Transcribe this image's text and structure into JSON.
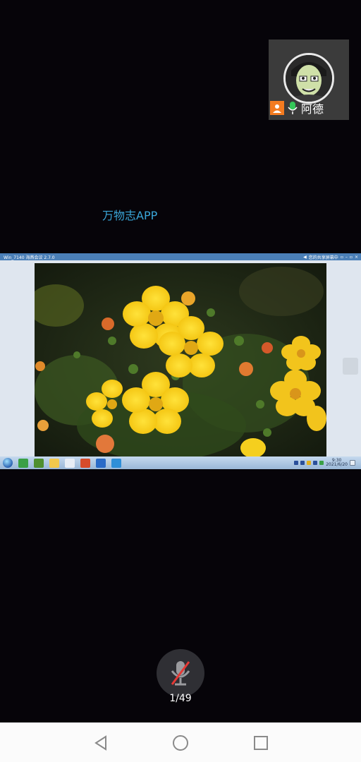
{
  "participant": {
    "name": "阿德",
    "role_icon": "person-icon",
    "mic_icon": "mic-on-icon",
    "accent_color": "#f47b20",
    "mic_color": "#34c759"
  },
  "watermark": {
    "text": "万物志APP",
    "color": "#3aa6d8"
  },
  "shared_screen": {
    "window_title": "Win_7140   海燕会议 2.7.0",
    "titlebar_status": "您的共享屏幕中",
    "tray_time": "9:30",
    "tray_date": "2021/6/20"
  },
  "controls": {
    "mute_icon": "mic-muted-icon",
    "page_counter": "1/49"
  },
  "navigation": {
    "back_icon": "back-triangle-icon",
    "home_icon": "home-circle-icon",
    "recent_icon": "recent-square-icon"
  }
}
